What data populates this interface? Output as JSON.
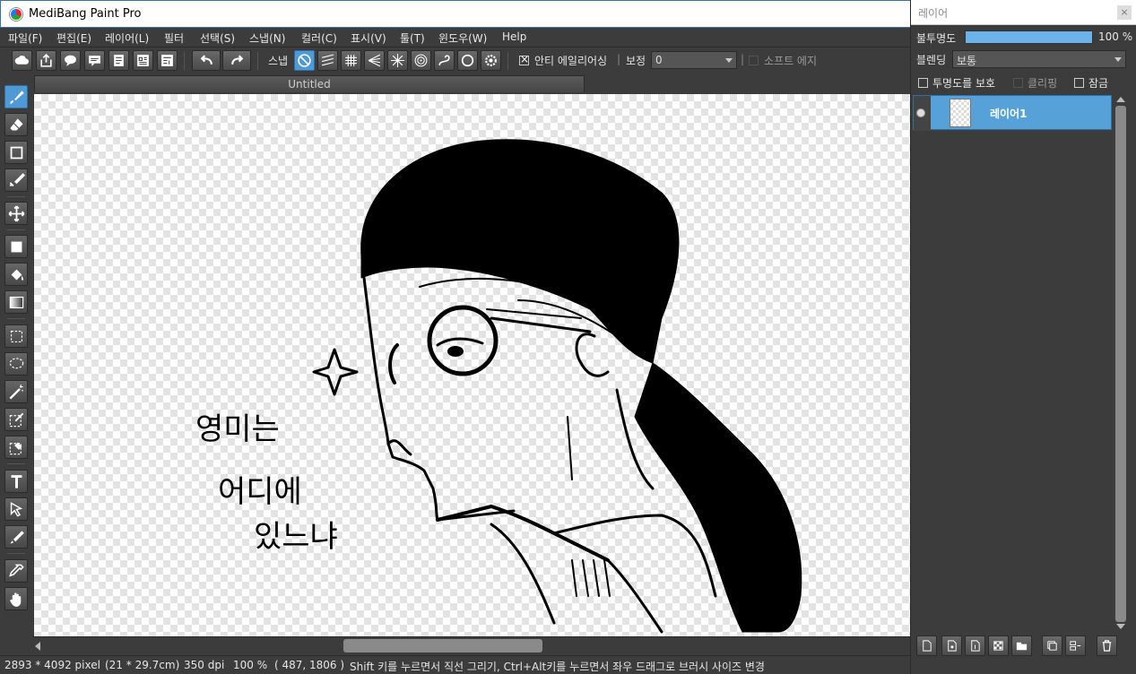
{
  "window": {
    "title": "MediBang Paint Pro"
  },
  "menu": {
    "items": [
      "파일(F)",
      "편집(E)",
      "레이어(L)",
      "필터",
      "선택(S)",
      "스냅(N)",
      "컬러(C)",
      "표시(V)",
      "툴(T)",
      "윈도우(W)",
      "Help"
    ]
  },
  "toolbar": {
    "snap_label": "스냅",
    "antialias_label": "안티 에일리어싱",
    "antialias_checked": true,
    "correction_label": "보정",
    "correction_value": "0",
    "soft_edge_label": "소프트 에지",
    "soft_edge_checked": false
  },
  "document": {
    "tab_title": "Untitled"
  },
  "canvas": {
    "handwritten_text": [
      "영미는",
      "어디에",
      "있느냐"
    ]
  },
  "status": {
    "pixel_size": "2893 * 4092 pixel",
    "cm_size": "(21 * 29.7cm)",
    "dpi": "350 dpi",
    "zoom": "100 %",
    "cursor": "( 487, 1806 )",
    "hint": "Shift 키를 누르면서 직선 그리기, Ctrl+Alt키를 누르면서 좌우 드래그로 브러시 사이즈 변경"
  },
  "layer_panel": {
    "title": "레이어",
    "close": "×",
    "opacity_label": "불투명도",
    "opacity_value": "100 %",
    "opacity_fraction": 1.0,
    "blend_label": "블렌딩",
    "blend_value": "보통",
    "protect_alpha_label": "투명도를 보호",
    "clipping_label": "클리핑",
    "lock_label": "잠금",
    "layers": [
      {
        "name": "레이어1",
        "visible": true,
        "selected": true
      }
    ]
  },
  "colors": {
    "accent": "#4f9ad6",
    "background": "#3c3c3c",
    "layer_selected": "#56a2d8"
  }
}
